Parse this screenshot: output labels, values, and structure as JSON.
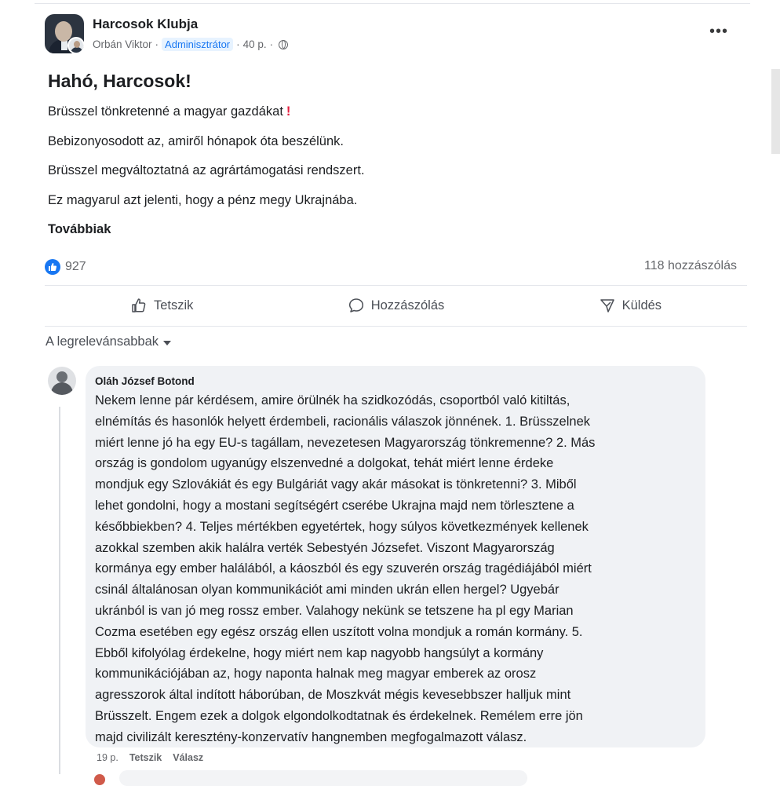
{
  "post": {
    "group_name": "Harcosok Klubja",
    "author": "Orbán Viktor",
    "role_badge": "Adminisztrátor",
    "time": "40 p.",
    "more_icon": "more-horizontal-icon",
    "headline": "Hahó, Harcosok!",
    "paragraphs": [
      "Brüsszel tönkretenné a magyar gazdákat",
      "Bebizonyosodott az, amiről hónapok óta beszélünk.",
      "Brüsszel megváltoztatná az agrártámogatási rendszert.",
      "Ez magyarul azt jelenti, hogy a pénz megy Ukrajnába."
    ],
    "see_more": "Továbbiak",
    "reaction_count": "927",
    "comment_count": "118 hozzászólás",
    "actions": {
      "like": "Tetszik",
      "comment": "Hozzászólás",
      "send": "Küldés"
    },
    "sort_label": "A legrelevánsabbak"
  },
  "comment": {
    "author": "Oláh József Botond",
    "lines": [
      "Nekem lenne pár kérdésem, amire örülnék ha szidkozódás, csoportból való kitiltás,",
      "elnémítás és hasonlók helyett érdembeli, racionális válaszok jönnének. 1. Brüsszelnek",
      "miért lenne jó ha egy EU-s tagállam, nevezetesen Magyarország tönkremenne? 2. Más",
      "ország is gondolom ugyanúgy elszenvedné a dolgokat, tehát miért lenne érdeke",
      "mondjuk egy Szlovákiát és egy Bulgáriát vagy akár másokat is tönkretenni? 3. Miből",
      "lehet gondolni, hogy a mostani segítségért cserébe Ukrajna majd nem törlesztene a",
      "későbbiekben? 4. Teljes mértékben egyetértek, hogy súlyos következmények kellenek",
      "azokkal szemben akik halálra verték Sebestyén Józsefet. Viszont Magyarország",
      "kormánya egy ember halálából, a káoszból és egy szuverén ország tragédiájából miért",
      "csinál általánosan olyan kommunikációt ami minden ukrán ellen hergel? Ugyebár",
      "ukránból is van jó meg rossz ember. Valahogy nekünk se tetszene ha pl egy Marian",
      "Cozma esetében egy egész ország ellen uszított volna mondjuk a román kormány. 5.",
      "Ebből kifolyólag érdekelne, hogy miért nem kap nagyobb hangsúlyt a kormány",
      "kommunikációjában az, hogy naponta halnak meg magyar emberek az orosz",
      "agresszorok által indított háborúban, de Moszkvát mégis kevesebbszer halljuk mint",
      "Brüsszelt. Engem ezek a dolgok elgondolkodtatnak és érdekelnek. Remélem erre jön",
      "majd civilizált keresztény-konzervatív hangnemben megfogalmazott válasz."
    ],
    "time": "19 p.",
    "like": "Tetszik",
    "reply": "Válasz"
  },
  "colors": {
    "accent": "#1877f2",
    "exclaim": "#e41e3f",
    "bubble": "#f0f2f5"
  }
}
